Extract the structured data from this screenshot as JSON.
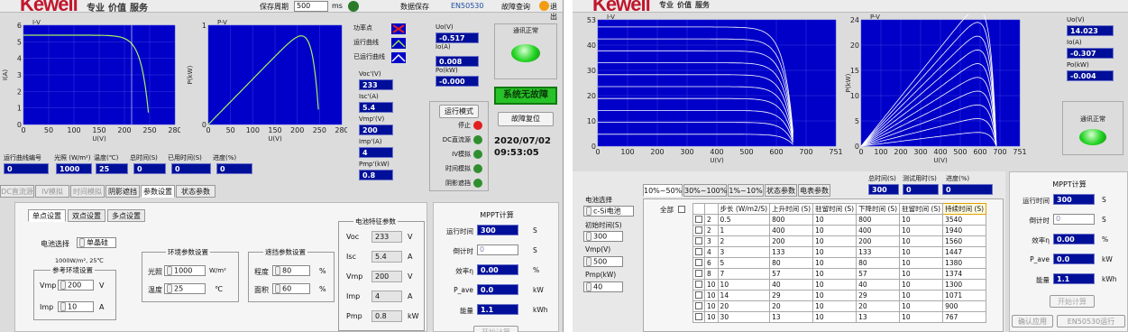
{
  "left": {
    "header": {
      "brand": "Kewell",
      "menu": [
        "专业",
        "价值",
        "服务"
      ],
      "save_period_label": "保存周期",
      "save_period_value": "500",
      "save_unit": "ms",
      "data_save": "数据保存",
      "en50530": "EN50530",
      "fault_query": "故障查询",
      "quit": "退出"
    },
    "iv_chart": {
      "title": "I-V",
      "xlabel": "U(V)",
      "ylabel": "I(A)",
      "xticks": [
        "0",
        "50",
        "100",
        "150",
        "200",
        "250",
        "280"
      ],
      "yticks": [
        "0",
        "1",
        "2",
        "3",
        "4",
        "5",
        "6"
      ]
    },
    "pv_chart": {
      "title": "P-V",
      "xlabel": "U(V)",
      "ylabel": "P(kW)",
      "xticks": [
        "0",
        "50",
        "100",
        "150",
        "200",
        "250",
        "280"
      ],
      "yticks": [
        "0",
        "1"
      ]
    },
    "legend": {
      "work_point": "功率点",
      "run_curve": "运行曲线",
      "ran_curve": "已运行曲线"
    },
    "readouts": {
      "voc_label": "Voc'(V)",
      "voc": "233",
      "isc_label": "Isc'(A)",
      "isc": "5.4",
      "vmp_label": "Vmp'(V)",
      "vmp": "200",
      "imp_label": "Imp'(A)",
      "imp": "4",
      "pmp_label": "Pmp'(kW)",
      "pmp": "0.8"
    },
    "outputs": {
      "uo_label": "Uo(V)",
      "uo": "-0.517",
      "io_label": "Io(A)",
      "io": "0.008",
      "po_label": "Po(kW)",
      "po": "-0.000"
    },
    "comm": {
      "label": "通讯正常",
      "color": "#22d322"
    },
    "status": {
      "no_fault": "系统无故障",
      "reset": "故障复位",
      "datetime": "2020/07/02 09:53:05"
    },
    "run_mode": {
      "title": "运行模式",
      "items": [
        {
          "label": "停止",
          "color": "#e02020"
        },
        {
          "label": "DC直流源",
          "color": "#2f8f2f"
        },
        {
          "label": "IV模拟",
          "color": "#2f8f2f"
        },
        {
          "label": "时间模拟",
          "color": "#2f8f2f"
        },
        {
          "label": "阴影遮挡",
          "color": "#2f8f2f"
        }
      ]
    },
    "curve_row": {
      "labels": [
        "运行曲线编号",
        "光照 (W/m²)",
        "温度(℃)",
        "总时间(S)",
        "已用时间(S)",
        "进度(%)"
      ],
      "values": [
        "0",
        "1000",
        "25",
        "0",
        "0",
        "0"
      ]
    },
    "tabs": [
      "DC直流源",
      "IV模拟",
      "时间模拟",
      "阴影遮挡",
      "参数设置",
      "状态参数"
    ],
    "subtabs": [
      "单点设置",
      "双点设置",
      "多点设置"
    ],
    "battery_select_label": "电池选择",
    "battery_select": "单晶硅",
    "ref_env": {
      "cond": "1000W/m², 25℃",
      "title": "参考环境设置",
      "vmp_label": "Vmp",
      "vmp": "200",
      "vmp_unit": "V",
      "imp_label": "Imp",
      "imp": "10",
      "imp_unit": "A"
    },
    "env": {
      "title": "环境参数设置",
      "light_label": "光照",
      "light": "1000",
      "light_unit": "W/m²",
      "temp_label": "温度",
      "temp": "25",
      "temp_unit": "℃"
    },
    "shade": {
      "title": "遮挡参数设置",
      "deg_label": "程度",
      "deg": "80",
      "deg_unit": "%",
      "area_label": "面积",
      "area": "60",
      "area_unit": "%"
    },
    "features": {
      "title": "电池特征参数",
      "rows": [
        {
          "label": "Voc",
          "value": "233",
          "unit": "V"
        },
        {
          "label": "Isc",
          "value": "5.4",
          "unit": "A"
        },
        {
          "label": "Vmp",
          "value": "200",
          "unit": "V"
        },
        {
          "label": "Imp",
          "value": "4",
          "unit": "A"
        },
        {
          "label": "Pmp",
          "value": "0.8",
          "unit": "kW"
        }
      ]
    },
    "mppt": {
      "title": "MPPT计算",
      "run_label": "运行时间",
      "run": "300",
      "run_unit": "S",
      "countdown_label": "倒计时",
      "countdown": "0",
      "countdown_unit": "S",
      "eff_label": "效率η",
      "eff": "0.00",
      "eff_unit": "%",
      "pave_label": "P_ave",
      "pave": "0.0",
      "pave_unit": "kW",
      "energy_label": "能量",
      "energy": "1.1",
      "energy_unit": "kWh",
      "start": "开始计算"
    }
  },
  "right": {
    "header": {
      "brand": "Kewell",
      "menu": [
        "专业",
        "价值",
        "服务"
      ]
    },
    "iv_chart": {
      "title": "I-V",
      "xlabel": "U(V)",
      "xticks": [
        "0",
        "100",
        "200",
        "300",
        "400",
        "500",
        "600",
        "700",
        "751"
      ],
      "yticks": [
        "0",
        "10",
        "20",
        "30",
        "40",
        "53"
      ]
    },
    "pv_chart": {
      "title": "P-V",
      "xlabel": "U(V)",
      "ylabel": "P(kW)",
      "xticks": [
        "0",
        "100",
        "200",
        "300",
        "400",
        "500",
        "600",
        "700",
        "751"
      ],
      "yticks": [
        "0",
        "5",
        "10",
        "15",
        "20",
        "24"
      ]
    },
    "outputs": {
      "uo_label": "Uo(V)",
      "uo": "14.023",
      "io_label": "Io(A)",
      "io": "-0.307",
      "po_label": "Po(kW)",
      "po": "-0.004"
    },
    "comm": {
      "label": "通讯正常"
    },
    "time_row": {
      "labels": [
        "总时间(S)",
        "测试用时(S)",
        "进度(%)"
      ],
      "values": [
        "300",
        "0",
        "0"
      ]
    },
    "battery_select_label": "电池选择",
    "battery_select": "c-Si电池",
    "init_time_label": "初始时间(S)",
    "init_time": "300",
    "vmp_label": "Vmp(V)",
    "vmp": "500",
    "pmp_label": "Pmp(kW)",
    "pmp": "40",
    "tabs": [
      "10%~50%",
      "30%~100%",
      "1%~10%",
      "状态参数",
      "电表参数"
    ],
    "table": {
      "all_label": "全部",
      "headers": [
        "步长 (W/m2/S)",
        "上升时间 (S)",
        "驻留时间 (S)",
        "下降时间 (S)",
        "驻留时间 (S)",
        "持续时间 (S)"
      ],
      "rows": [
        [
          "2",
          "0.5",
          "800",
          "10",
          "800",
          "10",
          "3540"
        ],
        [
          "2",
          "1",
          "400",
          "10",
          "400",
          "10",
          "1940"
        ],
        [
          "3",
          "2",
          "200",
          "10",
          "200",
          "10",
          "1560"
        ],
        [
          "4",
          "3",
          "133",
          "10",
          "133",
          "10",
          "1447"
        ],
        [
          "6",
          "5",
          "80",
          "10",
          "80",
          "10",
          "1380"
        ],
        [
          "8",
          "7",
          "57",
          "10",
          "57",
          "10",
          "1374"
        ],
        [
          "10",
          "10",
          "40",
          "10",
          "40",
          "10",
          "1300"
        ],
        [
          "10",
          "14",
          "29",
          "10",
          "29",
          "10",
          "1071"
        ],
        [
          "10",
          "20",
          "20",
          "10",
          "20",
          "10",
          "900"
        ],
        [
          "10",
          "30",
          "13",
          "10",
          "13",
          "10",
          "767"
        ]
      ]
    },
    "mppt": {
      "title": "MPPT计算",
      "run_label": "运行时间",
      "run": "300",
      "run_unit": "S",
      "countdown_label": "倒计时",
      "countdown": "0",
      "countdown_unit": "S",
      "eff_label": "效率η",
      "eff": "0.00",
      "eff_unit": "%",
      "pave_label": "P_ave",
      "pave": "0.0",
      "pave_unit": "kW",
      "energy_label": "能量",
      "energy": "1.1",
      "energy_unit": "kWh",
      "start": "开始计算"
    },
    "bottom": {
      "confirm": "确认应用",
      "en50530": "EN50530运行"
    }
  }
}
